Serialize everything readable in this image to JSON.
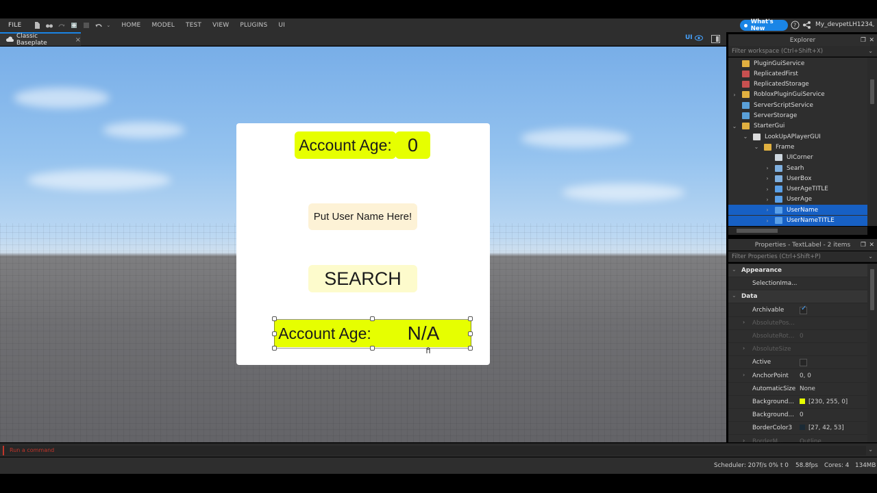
{
  "menubar": {
    "file": "FILE",
    "tabs": [
      "HOME",
      "MODEL",
      "TEST",
      "VIEW",
      "PLUGINS",
      "UI"
    ],
    "whats_new": "What's New",
    "username": "My_devpetLH1234"
  },
  "tabbar": {
    "tab_label": "Classic Baseplate",
    "ui_toggle": "UI"
  },
  "gui": {
    "account_age_title": "Account Age:",
    "account_age_value": "0",
    "user_box_placeholder": "Put User Name Here!",
    "search_button": "SEARCH",
    "bottom_age_title": "Account Age:",
    "bottom_age_value": "N/A"
  },
  "explorer": {
    "title": "Explorer",
    "filter_placeholder": "Filter workspace (Ctrl+Shift+X)",
    "items": [
      {
        "label": "PluginGuiService",
        "icon": "folder-icon",
        "depth": 0,
        "arrow": ""
      },
      {
        "label": "ReplicatedFirst",
        "icon": "service-icon",
        "depth": 0,
        "arrow": ""
      },
      {
        "label": "ReplicatedStorage",
        "icon": "service-icon",
        "depth": 0,
        "arrow": ""
      },
      {
        "label": "RobloxPluginGuiService",
        "icon": "folder-icon",
        "depth": 0,
        "arrow": "›"
      },
      {
        "label": "ServerScriptService",
        "icon": "script-service-icon",
        "depth": 0,
        "arrow": ""
      },
      {
        "label": "ServerStorage",
        "icon": "script-service-icon",
        "depth": 0,
        "arrow": ""
      },
      {
        "label": "StarterGui",
        "icon": "folder-icon",
        "depth": 0,
        "arrow": "⌄"
      },
      {
        "label": "LookUpAPlayerGUI",
        "icon": "screengui-icon",
        "depth": 1,
        "arrow": "⌄"
      },
      {
        "label": "Frame",
        "icon": "frame-icon",
        "depth": 2,
        "arrow": "⌄"
      },
      {
        "label": "UICorner",
        "icon": "uicorner-icon",
        "depth": 3,
        "arrow": ""
      },
      {
        "label": "Searh",
        "icon": "textbutton-icon",
        "depth": 3,
        "arrow": "›"
      },
      {
        "label": "UserBox",
        "icon": "textbox-icon",
        "depth": 3,
        "arrow": "›"
      },
      {
        "label": "UserAgeTITLE",
        "icon": "textlabel-icon",
        "depth": 3,
        "arrow": "›"
      },
      {
        "label": "UserAge",
        "icon": "textlabel-icon",
        "depth": 3,
        "arrow": "›"
      },
      {
        "label": "UserName",
        "icon": "textlabel-icon",
        "depth": 3,
        "arrow": "›",
        "selected": true
      },
      {
        "label": "UserNameTITLE",
        "icon": "textlabel-icon",
        "depth": 3,
        "arrow": "›",
        "selected": true
      }
    ]
  },
  "properties": {
    "title": "Properties - TextLabel - 2 items",
    "filter_placeholder": "Filter Properties (Ctrl+Shift+P)",
    "rows": [
      {
        "type": "section",
        "name": "Appearance"
      },
      {
        "type": "prop",
        "name": "SelectionIma...",
        "value": ""
      },
      {
        "type": "section",
        "name": "Data"
      },
      {
        "type": "check",
        "name": "Archivable",
        "checked": true
      },
      {
        "type": "prop",
        "name": "AbsolutePos...",
        "value": "",
        "disabled": true,
        "expand": true
      },
      {
        "type": "prop",
        "name": "AbsoluteRot...",
        "value": "0",
        "disabled": true
      },
      {
        "type": "prop",
        "name": "AbsoluteSize",
        "value": "",
        "disabled": true,
        "expand": true
      },
      {
        "type": "check",
        "name": "Active",
        "checked": false
      },
      {
        "type": "prop",
        "name": "AnchorPoint",
        "value": "0, 0",
        "expand": true
      },
      {
        "type": "prop",
        "name": "AutomaticSize",
        "value": "None"
      },
      {
        "type": "color",
        "name": "Background...",
        "value": "[230, 255, 0]",
        "color": "#e6ff00"
      },
      {
        "type": "prop",
        "name": "Background...",
        "value": "0"
      },
      {
        "type": "color",
        "name": "BorderColor3",
        "value": "[27, 42, 53]",
        "color": "#1b2a35"
      },
      {
        "type": "prop",
        "name": "BorderM...",
        "value": "Outline",
        "disabled": true,
        "expand": true
      }
    ]
  },
  "command_bar": {
    "placeholder": "Run a command"
  },
  "status": {
    "scheduler": "Scheduler: 207f/s 0%",
    "t": "t 0",
    "fps": "58.8fps",
    "cores": "Cores: 4",
    "memory": "134MB"
  }
}
